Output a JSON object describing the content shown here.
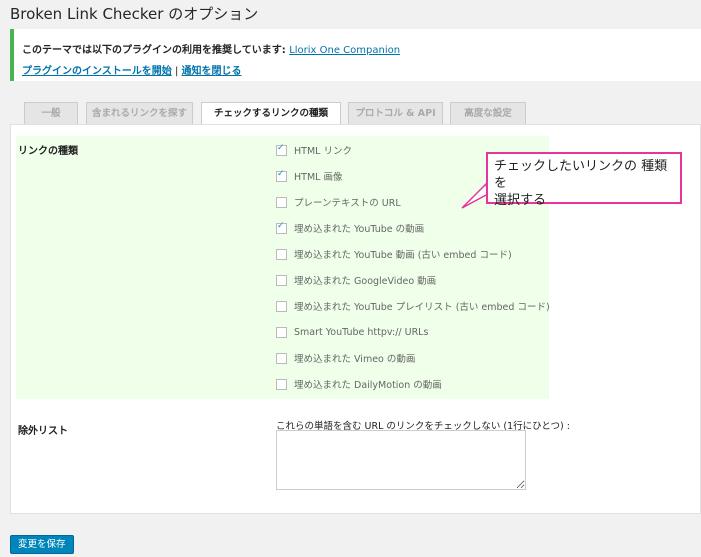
{
  "page": {
    "title": "Broken Link Checker のオプション"
  },
  "notice": {
    "text": "このテーマでは以下のプラグインの利用を推奨しています:",
    "plugin_link": "Llorix One Companion",
    "install_link": "プラグインのインストールを開始",
    "separator": " | ",
    "dismiss_link": "通知を閉じる"
  },
  "tabs": [
    {
      "label": "一般"
    },
    {
      "label": "含まれるリンクを探す"
    },
    {
      "label": "チェックするリンクの種類"
    },
    {
      "label": "プロトコル & API"
    },
    {
      "label": "高度な設定"
    }
  ],
  "link_types": {
    "label": "リンクの種類",
    "options": [
      {
        "label": "HTML リンク",
        "checked": true
      },
      {
        "label": "HTML 画像",
        "checked": true
      },
      {
        "label": "プレーンテキストの URL",
        "checked": false
      },
      {
        "label": "埋め込まれた YouTube の動画",
        "checked": true
      },
      {
        "label": "埋め込まれた YouTube 動画 (古い embed コード)",
        "checked": false
      },
      {
        "label": "埋め込まれた GoogleVideo 動画",
        "checked": false
      },
      {
        "label": "埋め込まれた YouTube プレイリスト (古い embed コード)",
        "checked": false
      },
      {
        "label": "Smart YouTube httpv:// URLs",
        "checked": false
      },
      {
        "label": "埋め込まれた Vimeo の動画",
        "checked": false
      },
      {
        "label": "埋め込まれた DailyMotion の動画",
        "checked": false
      }
    ]
  },
  "exclusion": {
    "label": "除外リスト",
    "description": "これらの単語を含む URL のリンクをチェックしない (1行にひとつ) :",
    "value": ""
  },
  "callout": {
    "line1": "チェックしたいリンクの 種類を",
    "line2": "選択する",
    "border_color": "#e8359c"
  },
  "actions": {
    "save_label": "変更を保存"
  }
}
